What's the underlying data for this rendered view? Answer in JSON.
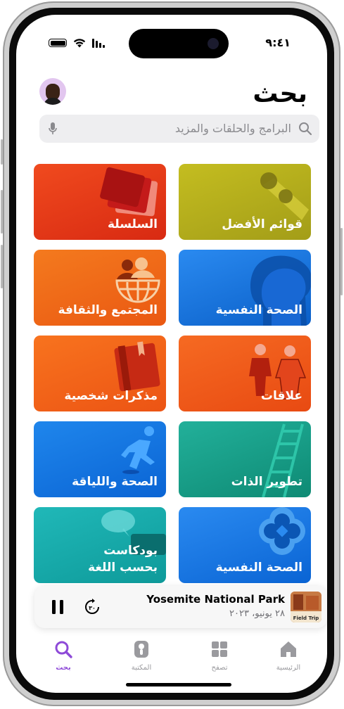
{
  "status": {
    "time": "٩:٤١"
  },
  "header": {
    "title": "بحث"
  },
  "search": {
    "placeholder": "البرامج والحلقات والمزيد"
  },
  "categories": [
    {
      "label": "قوائم الأفضل",
      "color": "#b7b21f"
    },
    {
      "label": "السلسلة",
      "color": "#e8391a"
    },
    {
      "label": "الصحة النفسية",
      "color": "#1a7de6"
    },
    {
      "label": "المجتمع والثقافة",
      "color": "#f26418"
    },
    {
      "label": "علاقات",
      "color": "#f2571a"
    },
    {
      "label": "مذكرات شخصية",
      "color": "#f25c1a"
    },
    {
      "label": "تطوير الذات",
      "color": "#1aa08a"
    },
    {
      "label": "الصحة واللياقة",
      "color": "#1a7de6"
    },
    {
      "label": "الصحة النفسية",
      "color": "#1a7de6"
    },
    {
      "label_line1": "بودكاست",
      "label_line2": "بحسب اللغة",
      "color": "#1ab0b0"
    }
  ],
  "now_playing": {
    "title": "Yosemite National Park",
    "date": "٢٨ يونيو، ٢٠٢٣",
    "artwork_text": "Field Trip",
    "skip_label": "٣٠"
  },
  "tabs": [
    {
      "label": "الرئيسية",
      "icon": "home-icon",
      "active": false
    },
    {
      "label": "تصفح",
      "icon": "grid-icon",
      "active": false
    },
    {
      "label": "المكتبة",
      "icon": "library-icon",
      "active": false
    },
    {
      "label": "بحث",
      "icon": "search-icon",
      "active": true
    }
  ],
  "colors": {
    "accent": "#8e4ad8",
    "tab_inactive": "#9a9a9e"
  }
}
